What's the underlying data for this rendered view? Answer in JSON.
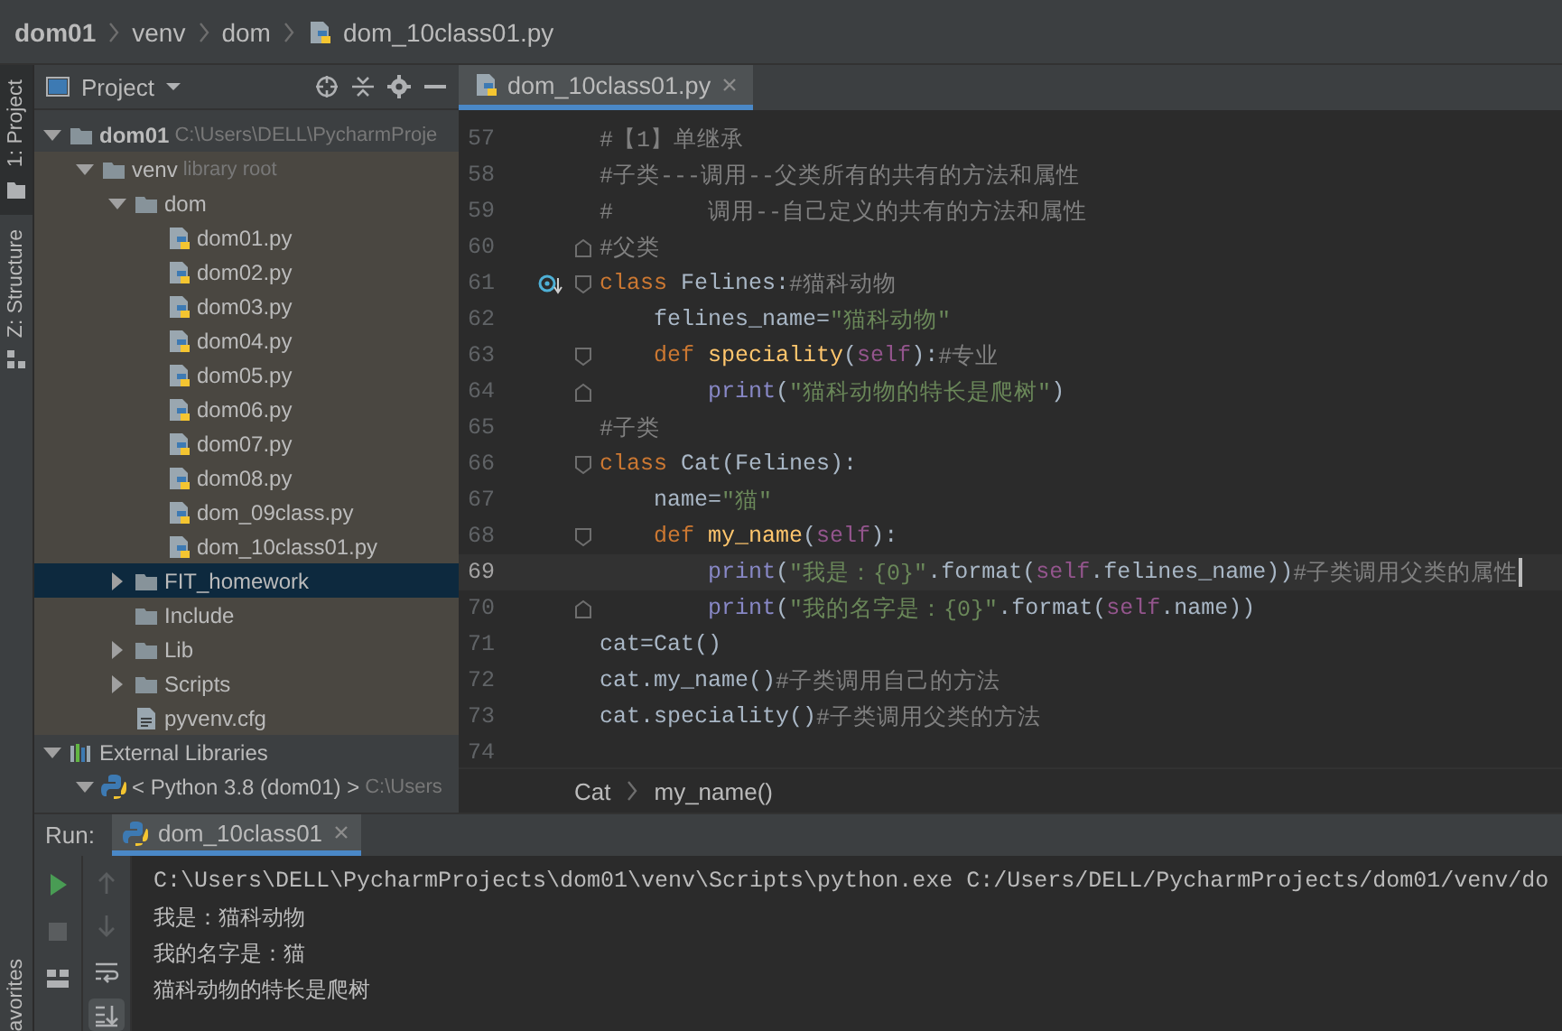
{
  "breadcrumb": [
    {
      "label": "dom01",
      "kind": "folder"
    },
    {
      "label": "venv",
      "kind": "folder"
    },
    {
      "label": "dom",
      "kind": "folder"
    },
    {
      "label": "dom_10class01.py",
      "kind": "python"
    }
  ],
  "side_tabs": [
    {
      "label": "1: Project",
      "kind": "project",
      "selected": true
    },
    {
      "label": "Z: Structure",
      "kind": "structure",
      "selected": false
    }
  ],
  "side_tabs_bottom": [
    {
      "label": "avorites",
      "selected": false
    }
  ],
  "project_panel": {
    "title": "Project",
    "tree": [
      {
        "label": "dom01",
        "hint": "C:\\Users\\DELL\\PycharmProje",
        "kind": "folder",
        "expanded": true,
        "selected": false,
        "library_scope": false,
        "children": [
          {
            "label": "venv",
            "hint": "library root",
            "kind": "folder",
            "expanded": true,
            "selected": false,
            "library_scope": true,
            "children": [
              {
                "label": "dom",
                "kind": "folder",
                "expanded": true,
                "selected": false,
                "library_scope": true,
                "children": [
                  {
                    "label": "dom01.py",
                    "kind": "python",
                    "selected": false,
                    "library_scope": true
                  },
                  {
                    "label": "dom02.py",
                    "kind": "python",
                    "selected": false,
                    "library_scope": true
                  },
                  {
                    "label": "dom03.py",
                    "kind": "python",
                    "selected": false,
                    "library_scope": true
                  },
                  {
                    "label": "dom04.py",
                    "kind": "python",
                    "selected": false,
                    "library_scope": true
                  },
                  {
                    "label": "dom05.py",
                    "kind": "python",
                    "selected": false,
                    "library_scope": true
                  },
                  {
                    "label": "dom06.py",
                    "kind": "python",
                    "selected": false,
                    "library_scope": true
                  },
                  {
                    "label": "dom07.py",
                    "kind": "python",
                    "selected": false,
                    "library_scope": true
                  },
                  {
                    "label": "dom08.py",
                    "kind": "python",
                    "selected": false,
                    "library_scope": true
                  },
                  {
                    "label": "dom_09class.py",
                    "kind": "python",
                    "selected": false,
                    "library_scope": true
                  },
                  {
                    "label": "dom_10class01.py",
                    "kind": "python",
                    "selected": false,
                    "library_scope": true
                  }
                ]
              },
              {
                "label": "FIT_homework",
                "kind": "folder",
                "expanded": false,
                "selected": true,
                "library_scope": true
              },
              {
                "label": "Include",
                "kind": "folder",
                "selected": false,
                "library_scope": true
              },
              {
                "label": "Lib",
                "kind": "folder",
                "expanded": false,
                "selected": false,
                "library_scope": true
              },
              {
                "label": "Scripts",
                "kind": "folder",
                "expanded": false,
                "selected": false,
                "library_scope": true
              },
              {
                "label": "pyvenv.cfg",
                "kind": "file",
                "selected": false,
                "library_scope": true
              }
            ]
          }
        ]
      },
      {
        "label": "External Libraries",
        "kind": "library",
        "expanded": true,
        "selected": false,
        "library_scope": false,
        "children": [
          {
            "label": "< Python 3.8 (dom01) >",
            "hint": "C:\\Users",
            "kind": "sdk",
            "expanded": true,
            "selected": false,
            "library_scope": false
          }
        ]
      }
    ]
  },
  "editor": {
    "tabs": [
      {
        "label": "dom_10class01.py",
        "selected": true
      }
    ],
    "lines": [
      {
        "number": "57",
        "fold_start": false,
        "fold_end": false,
        "marker": false,
        "current": false,
        "tokens": [
          {
            "kind": "comment",
            "text": "#【1】单继承"
          }
        ]
      },
      {
        "number": "58",
        "fold_start": false,
        "fold_end": false,
        "marker": false,
        "current": false,
        "tokens": [
          {
            "kind": "comment",
            "text": "#子类---调用--父类所有的共有的方法和属性"
          }
        ]
      },
      {
        "number": "59",
        "fold_start": false,
        "fold_end": false,
        "marker": false,
        "current": false,
        "tokens": [
          {
            "kind": "comment",
            "text": "#       调用--自己定义的共有的方法和属性"
          }
        ]
      },
      {
        "number": "60",
        "fold_start": false,
        "fold_end": true,
        "marker": false,
        "current": false,
        "tokens": [
          {
            "kind": "comment",
            "text": "#父类"
          }
        ]
      },
      {
        "number": "61",
        "fold_start": true,
        "fold_end": false,
        "marker": true,
        "current": false,
        "tokens": [
          {
            "kind": "keyword",
            "text": "class "
          },
          {
            "kind": "plain",
            "text": "Felines:"
          },
          {
            "kind": "comment",
            "text": "#猫科动物"
          }
        ]
      },
      {
        "number": "62",
        "fold_start": false,
        "fold_end": false,
        "marker": false,
        "current": false,
        "tokens": [
          {
            "kind": "plain",
            "text": "    felines_name="
          },
          {
            "kind": "string",
            "text": "\"猫科动物\""
          }
        ]
      },
      {
        "number": "63",
        "fold_start": true,
        "fold_end": false,
        "marker": false,
        "current": false,
        "tokens": [
          {
            "kind": "keyword",
            "text": "    def "
          },
          {
            "kind": "function",
            "text": "speciality"
          },
          {
            "kind": "plain",
            "text": "("
          },
          {
            "kind": "self",
            "text": "self"
          },
          {
            "kind": "plain",
            "text": "):"
          },
          {
            "kind": "comment",
            "text": "#专业"
          }
        ]
      },
      {
        "number": "64",
        "fold_start": false,
        "fold_end": true,
        "marker": false,
        "current": false,
        "tokens": [
          {
            "kind": "builtin",
            "text": "        print"
          },
          {
            "kind": "plain",
            "text": "("
          },
          {
            "kind": "string",
            "text": "\"猫科动物的特长是爬树\""
          },
          {
            "kind": "plain",
            "text": ")"
          }
        ]
      },
      {
        "number": "65",
        "fold_start": false,
        "fold_end": false,
        "marker": false,
        "current": false,
        "tokens": [
          {
            "kind": "comment",
            "text": "#子类"
          }
        ]
      },
      {
        "number": "66",
        "fold_start": true,
        "fold_end": false,
        "marker": false,
        "current": false,
        "tokens": [
          {
            "kind": "keyword",
            "text": "class "
          },
          {
            "kind": "plain",
            "text": "Cat(Felines):"
          }
        ]
      },
      {
        "number": "67",
        "fold_start": false,
        "fold_end": false,
        "marker": false,
        "current": false,
        "tokens": [
          {
            "kind": "plain",
            "text": "    name="
          },
          {
            "kind": "string",
            "text": "\"猫\""
          }
        ]
      },
      {
        "number": "68",
        "fold_start": true,
        "fold_end": false,
        "marker": false,
        "current": false,
        "tokens": [
          {
            "kind": "keyword",
            "text": "    def "
          },
          {
            "kind": "function",
            "text": "my_name"
          },
          {
            "kind": "plain",
            "text": "("
          },
          {
            "kind": "self",
            "text": "self"
          },
          {
            "kind": "plain",
            "text": "):"
          }
        ]
      },
      {
        "number": "69",
        "fold_start": false,
        "fold_end": false,
        "marker": false,
        "current": true,
        "tokens": [
          {
            "kind": "builtin",
            "text": "        print"
          },
          {
            "kind": "plain",
            "text": "("
          },
          {
            "kind": "string",
            "text": "\"我是：{0}\""
          },
          {
            "kind": "plain",
            "text": ".format("
          },
          {
            "kind": "self",
            "text": "self"
          },
          {
            "kind": "plain",
            "text": ".felines_name))"
          },
          {
            "kind": "comment",
            "text": "#子类调用父类的属性"
          }
        ]
      },
      {
        "number": "70",
        "fold_start": false,
        "fold_end": true,
        "marker": false,
        "current": false,
        "tokens": [
          {
            "kind": "builtin",
            "text": "        print"
          },
          {
            "kind": "plain",
            "text": "("
          },
          {
            "kind": "string",
            "text": "\"我的名字是：{0}\""
          },
          {
            "kind": "plain",
            "text": ".format("
          },
          {
            "kind": "self",
            "text": "self"
          },
          {
            "kind": "plain",
            "text": ".name))"
          }
        ]
      },
      {
        "number": "71",
        "fold_start": false,
        "fold_end": false,
        "marker": false,
        "current": false,
        "tokens": [
          {
            "kind": "plain",
            "text": "cat=Cat()"
          }
        ]
      },
      {
        "number": "72",
        "fold_start": false,
        "fold_end": false,
        "marker": false,
        "current": false,
        "tokens": [
          {
            "kind": "plain",
            "text": "cat.my_name()"
          },
          {
            "kind": "comment",
            "text": "#子类调用自己的方法"
          }
        ]
      },
      {
        "number": "73",
        "fold_start": false,
        "fold_end": false,
        "marker": false,
        "current": false,
        "tokens": [
          {
            "kind": "plain",
            "text": "cat.speciality()"
          },
          {
            "kind": "comment",
            "text": "#子类调用父类的方法"
          }
        ]
      },
      {
        "number": "74",
        "fold_start": false,
        "fold_end": false,
        "marker": false,
        "current": false
      }
    ],
    "breadcrumb": [
      "Cat",
      "my_name()"
    ]
  },
  "run_panel": {
    "label": "Run:",
    "tabs": [
      {
        "label": "dom_10class01",
        "selected": true
      }
    ],
    "output": [
      {
        "kind": "command",
        "text": "C:\\Users\\DELL\\PycharmProjects\\dom01\\venv\\Scripts\\python.exe C:/Users/DELL/PycharmProjects/dom01/venv/do"
      },
      {
        "kind": "stdout",
        "text": "我是：猫科动物"
      },
      {
        "kind": "stdout",
        "text": "我的名字是：猫"
      },
      {
        "kind": "stdout",
        "text": "猫科动物的特长是爬树"
      }
    ]
  }
}
